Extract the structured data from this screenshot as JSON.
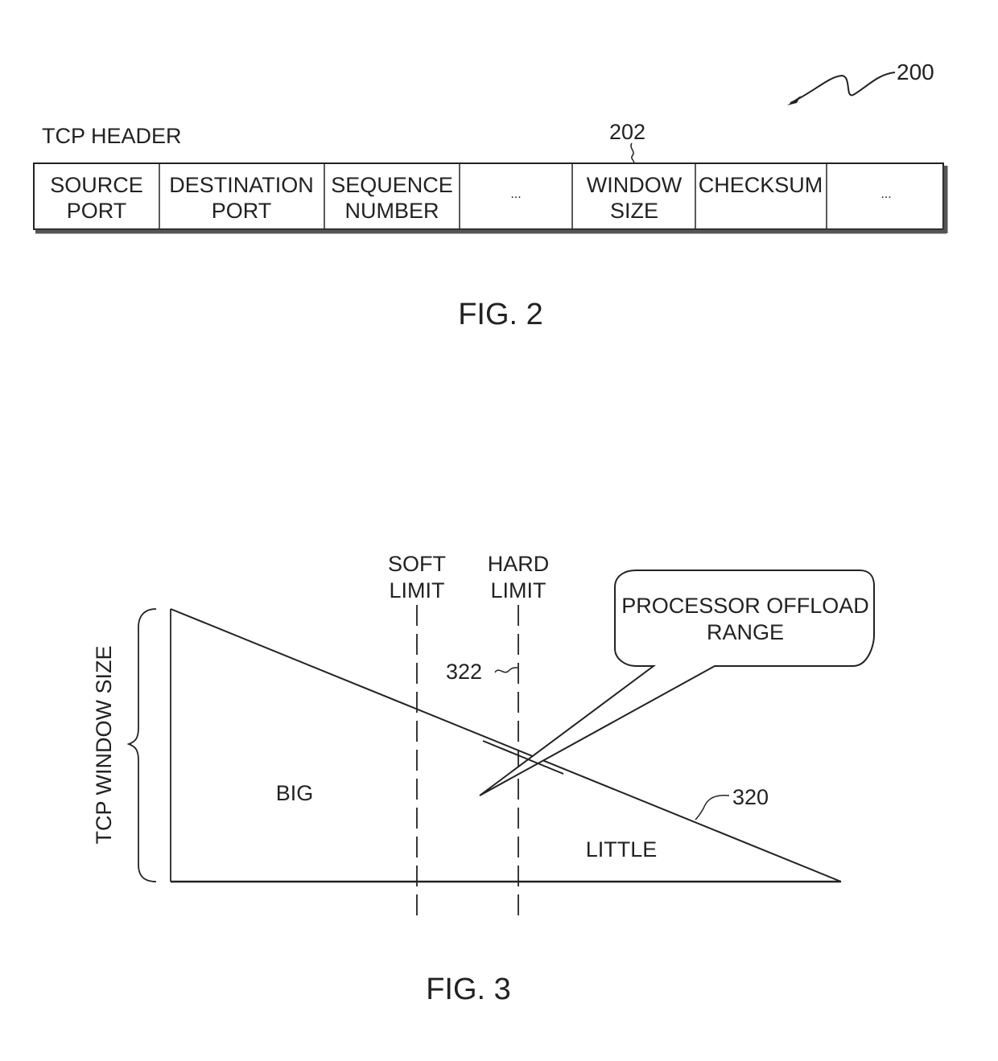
{
  "figure2": {
    "ref_number": "200",
    "header_label": "TCP HEADER",
    "field_ref": "202",
    "fields": [
      {
        "line1": "SOURCE",
        "line2": "PORT"
      },
      {
        "line1": "DESTINATION",
        "line2": "PORT"
      },
      {
        "line1": "SEQUENCE",
        "line2": "NUMBER"
      },
      {
        "line1": "...",
        "line2": ""
      },
      {
        "line1": "WINDOW",
        "line2": "SIZE"
      },
      {
        "line1": "CHECKSUM",
        "line2": ""
      },
      {
        "line1": "...",
        "line2": ""
      }
    ],
    "caption": "FIG. 2"
  },
  "figure3": {
    "y_axis_label": "TCP WINDOW SIZE",
    "soft_limit": {
      "line1": "SOFT",
      "line2": "LIMIT"
    },
    "hard_limit": {
      "line1": "HARD",
      "line2": "LIMIT"
    },
    "hard_limit_ref": "322",
    "callout": {
      "line1": "PROCESSOR OFFLOAD",
      "line2": "RANGE"
    },
    "region_big": "BIG",
    "region_little": "LITTLE",
    "curve_ref": "320",
    "caption": "FIG. 3"
  }
}
